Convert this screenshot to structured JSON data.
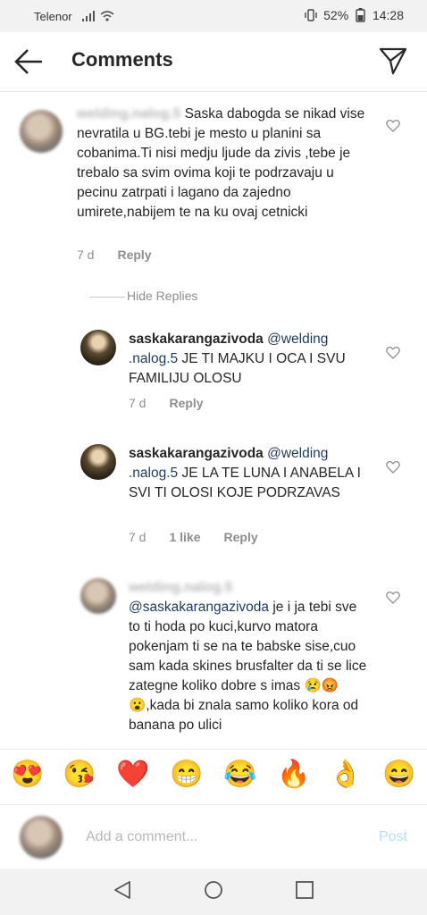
{
  "status": {
    "carrier": "Telenor",
    "battery": "52%",
    "time": "14:28"
  },
  "header": {
    "title": "Comments"
  },
  "comments": [
    {
      "username": "welding.nalog.5",
      "text": "Saska dabogda se nikad vise nevratila u BG.tebi je mesto u planini sa cobanima.Ti nisi medju ljude da zivis ,tebe je trebalo sa svim ovima koji te podrzavaju u pecinu zatrpati i lagano da zajedno umirete,nabijem te na ku ovaj cetnicki",
      "time": "7 d",
      "reply": "Reply"
    }
  ],
  "hide_replies": "Hide Replies",
  "replies": [
    {
      "username": "saskakarangazivoda",
      "mention": "@welding .nalog.5",
      "text": "JE TI MAJKU I OCA I SVU FAMILIJU OLOSU",
      "time": "7 d",
      "reply": "Reply"
    },
    {
      "username": "saskakarangazivoda",
      "mention": "@welding .nalog.5",
      "text": "JE LA TE LUNA I ANABELA I SVI TI OLOSI KOJE PODRZAVAS",
      "time": "7 d",
      "likes": "1 like",
      "reply": "Reply"
    },
    {
      "username": "welding.nalog.5",
      "mention": "@saskakarangazivoda",
      "text": "je i ja tebi sve to ti hoda po kuci,kurvo matora pokenjam ti se na te babske sise,cuo sam kada skines brusfalter da ti se lice zategne koliko dobre s imas",
      "emojis": "😢😡😮",
      "text2": ",kada bi znala samo koliko kora od banana po ulici"
    }
  ],
  "emoji_bar": [
    "😍",
    "😘",
    "❤️",
    "😁",
    "😂",
    "🔥",
    "👌",
    "😄"
  ],
  "add_comment": {
    "placeholder": "Add a comment...",
    "post": "Post"
  },
  "nav": {
    "back_icon": "triangle-back-icon",
    "home_icon": "circle-home-icon",
    "recents_icon": "square-recents-icon"
  }
}
